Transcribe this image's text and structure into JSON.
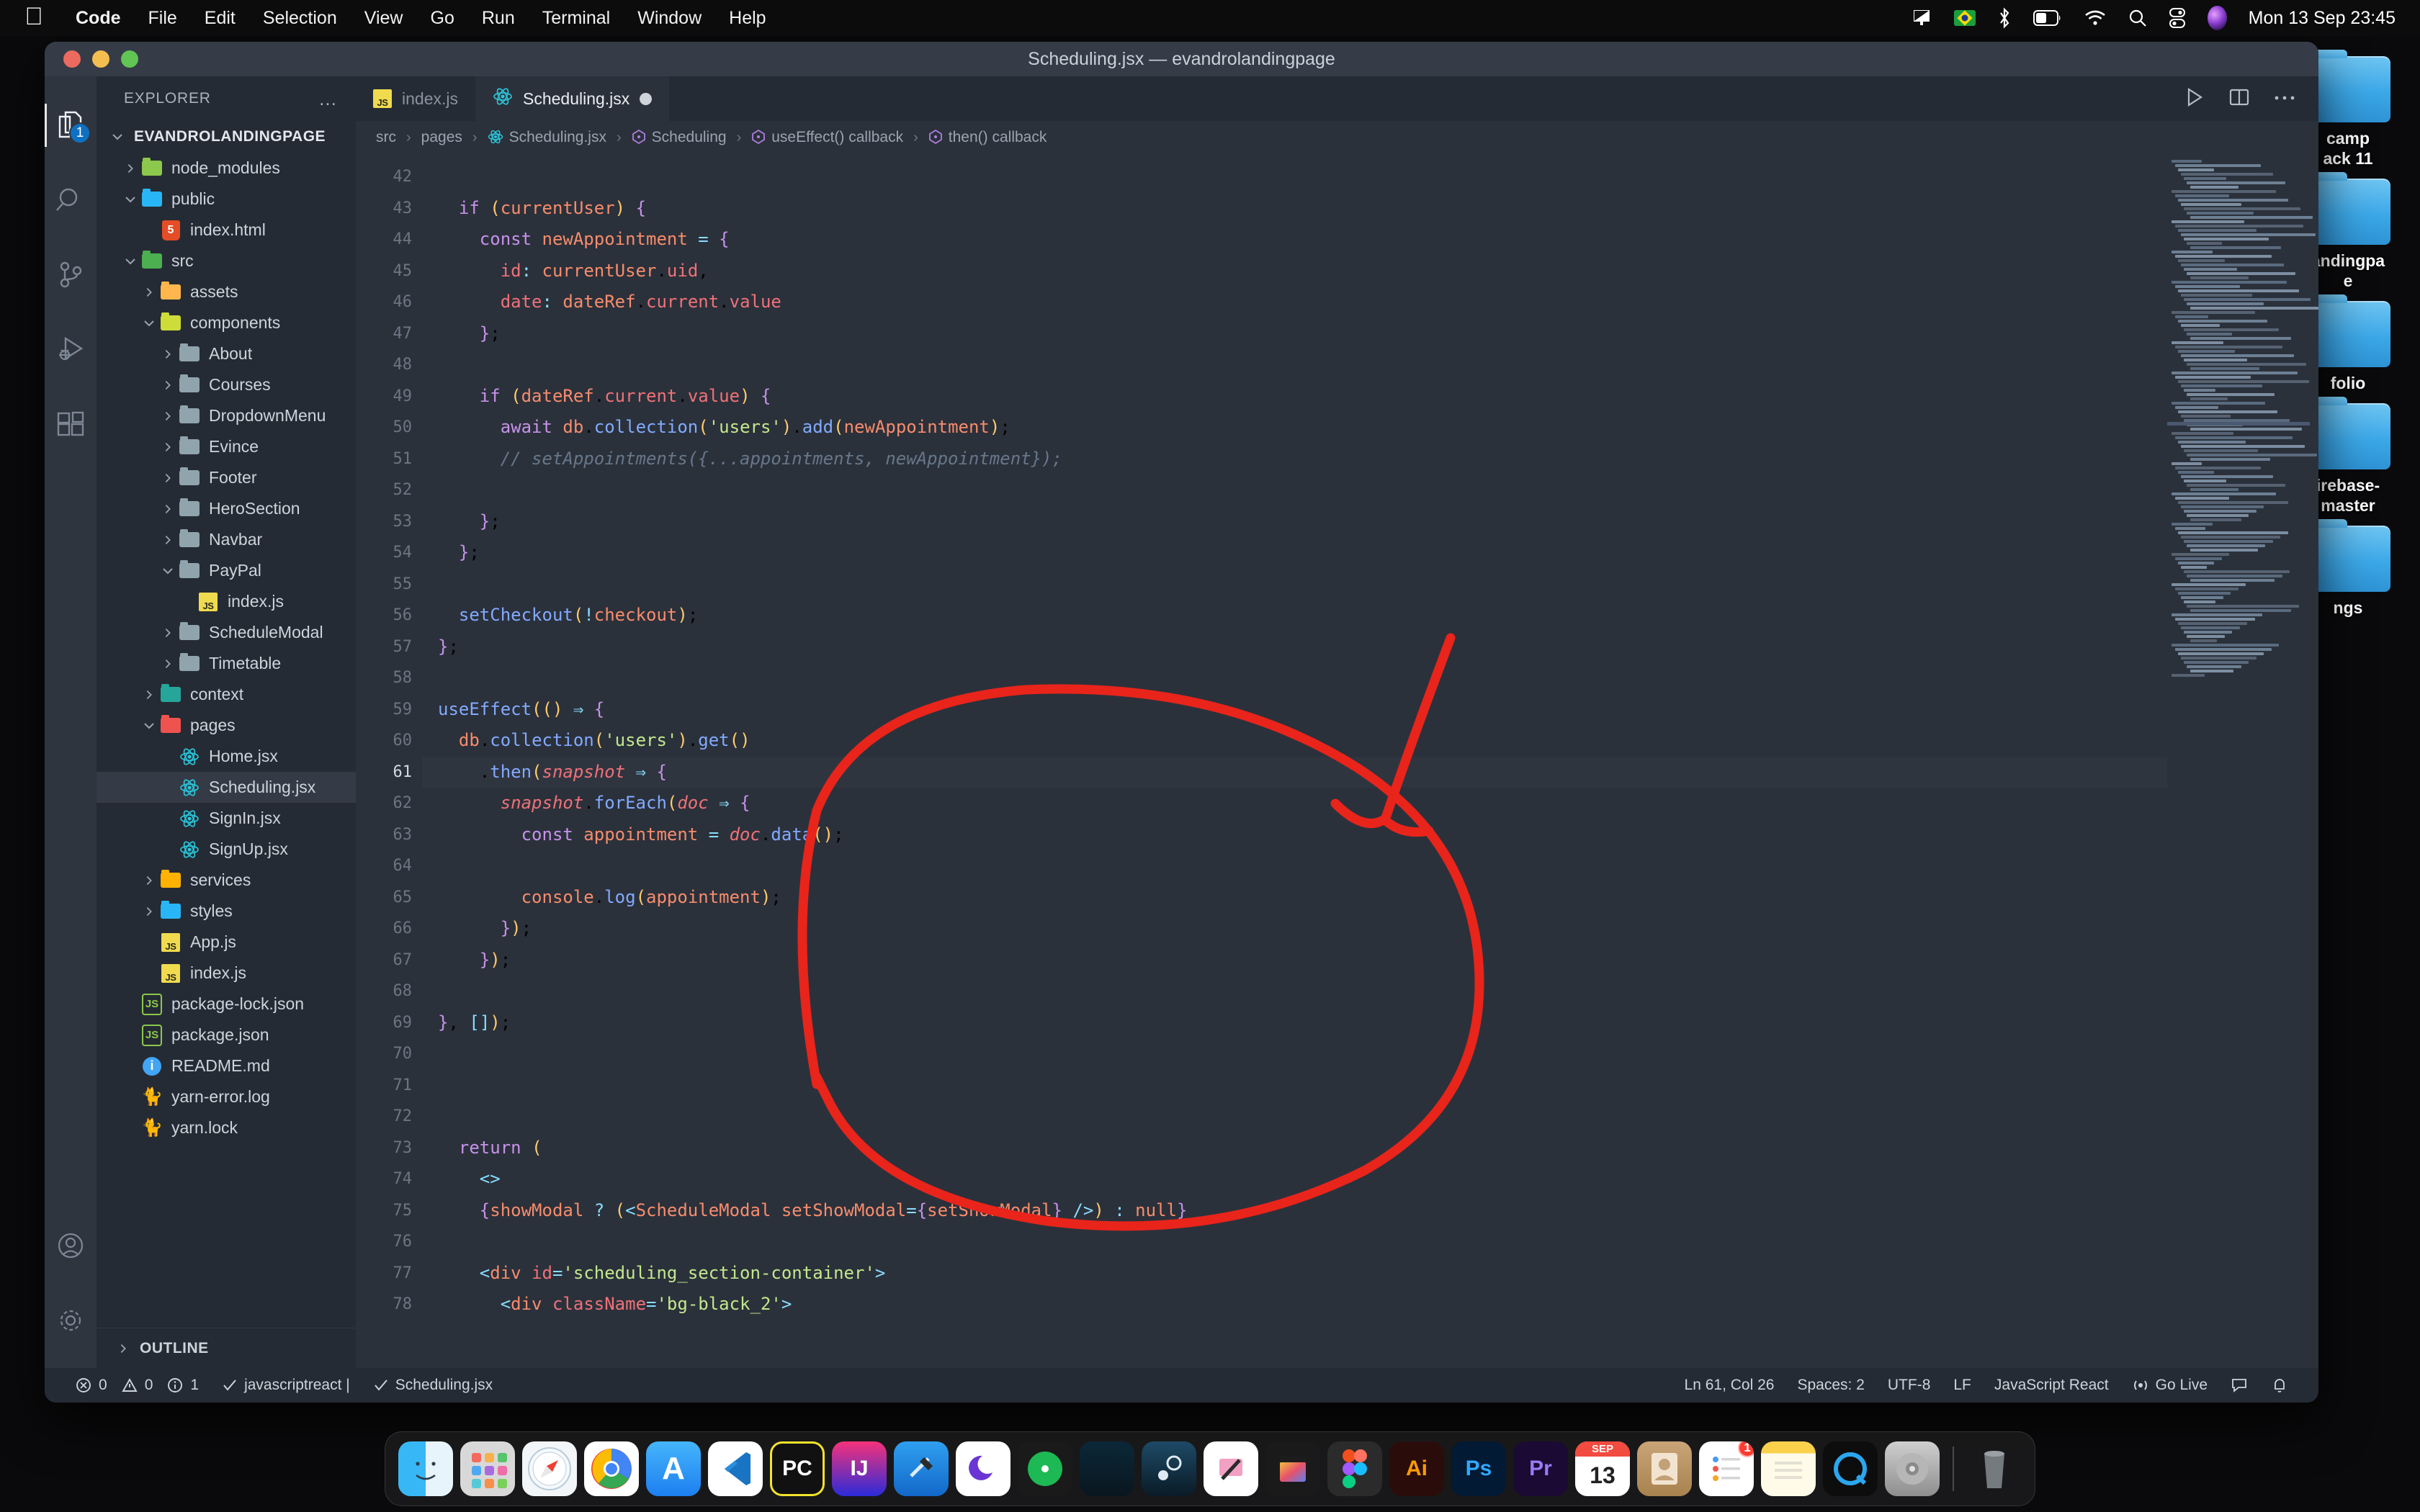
{
  "menubar": {
    "apple": "apple-logo",
    "items": [
      "Code",
      "File",
      "Edit",
      "Selection",
      "View",
      "Go",
      "Run",
      "Terminal",
      "Window",
      "Help"
    ],
    "status_icons": [
      "display-icon",
      "brazil-flag-icon",
      "bluetooth-icon",
      "battery-icon",
      "wifi-icon",
      "search-icon",
      "control-center-icon",
      "siri-icon"
    ],
    "clock": "Mon 13 Sep  23:45"
  },
  "window": {
    "title": "Scheduling.jsx — evandrolandingpage"
  },
  "activitybar": {
    "items": [
      {
        "name": "explorer",
        "icon": "files-icon",
        "badge": "1",
        "active": true
      },
      {
        "name": "search",
        "icon": "search-icon",
        "badge": "",
        "active": false
      },
      {
        "name": "source-control",
        "icon": "source-control-icon",
        "badge": "",
        "active": false
      },
      {
        "name": "run-debug",
        "icon": "run-debug-icon",
        "badge": "",
        "active": false
      },
      {
        "name": "extensions",
        "icon": "extensions-icon",
        "badge": "",
        "active": false
      }
    ],
    "bottom": [
      {
        "name": "accounts",
        "icon": "account-icon"
      },
      {
        "name": "settings",
        "icon": "gear-icon"
      }
    ]
  },
  "sidebar": {
    "title": "EXPLORER",
    "more_actions": "…",
    "root": "EVANDROLANDINGPAGE",
    "outline_label": "OUTLINE",
    "tree": [
      {
        "label": "node_modules",
        "depth": 1,
        "type": "folder",
        "state": "collapsed",
        "color": "#8cc84b"
      },
      {
        "label": "public",
        "depth": 1,
        "type": "folder",
        "state": "expanded",
        "color": "#29b6f6"
      },
      {
        "label": "index.html",
        "depth": 2,
        "type": "html"
      },
      {
        "label": "src",
        "depth": 1,
        "type": "folder",
        "state": "expanded",
        "color": "#4caf50"
      },
      {
        "label": "assets",
        "depth": 2,
        "type": "folder",
        "state": "collapsed",
        "color": "#ffb74d"
      },
      {
        "label": "components",
        "depth": 2,
        "type": "folder",
        "state": "expanded",
        "color": "#cddc39"
      },
      {
        "label": "About",
        "depth": 3,
        "type": "folder",
        "state": "collapsed",
        "color": "#90a4ae"
      },
      {
        "label": "Courses",
        "depth": 3,
        "type": "folder",
        "state": "collapsed",
        "color": "#90a4ae"
      },
      {
        "label": "DropdownMenu",
        "depth": 3,
        "type": "folder",
        "state": "collapsed",
        "color": "#90a4ae"
      },
      {
        "label": "Evince",
        "depth": 3,
        "type": "folder",
        "state": "collapsed",
        "color": "#90a4ae"
      },
      {
        "label": "Footer",
        "depth": 3,
        "type": "folder",
        "state": "collapsed",
        "color": "#90a4ae"
      },
      {
        "label": "HeroSection",
        "depth": 3,
        "type": "folder",
        "state": "collapsed",
        "color": "#90a4ae"
      },
      {
        "label": "Navbar",
        "depth": 3,
        "type": "folder",
        "state": "collapsed",
        "color": "#90a4ae"
      },
      {
        "label": "PayPal",
        "depth": 3,
        "type": "folder",
        "state": "expanded",
        "color": "#90a4ae"
      },
      {
        "label": "index.js",
        "depth": 4,
        "type": "js"
      },
      {
        "label": "ScheduleModal",
        "depth": 3,
        "type": "folder",
        "state": "collapsed",
        "color": "#90a4ae"
      },
      {
        "label": "Timetable",
        "depth": 3,
        "type": "folder",
        "state": "collapsed",
        "color": "#90a4ae"
      },
      {
        "label": "context",
        "depth": 2,
        "type": "folder",
        "state": "collapsed",
        "color": "#26a69a"
      },
      {
        "label": "pages",
        "depth": 2,
        "type": "folder",
        "state": "expanded",
        "color": "#ef5350"
      },
      {
        "label": "Home.jsx",
        "depth": 3,
        "type": "react"
      },
      {
        "label": "Scheduling.jsx",
        "depth": 3,
        "type": "react",
        "selected": true
      },
      {
        "label": "SignIn.jsx",
        "depth": 3,
        "type": "react"
      },
      {
        "label": "SignUp.jsx",
        "depth": 3,
        "type": "react"
      },
      {
        "label": "services",
        "depth": 2,
        "type": "folder",
        "state": "collapsed",
        "color": "#ffb300"
      },
      {
        "label": "styles",
        "depth": 2,
        "type": "folder",
        "state": "collapsed",
        "color": "#29b6f6"
      },
      {
        "label": "App.js",
        "depth": 2,
        "type": "js"
      },
      {
        "label": "index.js",
        "depth": 2,
        "type": "js"
      },
      {
        "label": "package-lock.json",
        "depth": 1,
        "type": "node"
      },
      {
        "label": "package.json",
        "depth": 1,
        "type": "node"
      },
      {
        "label": "README.md",
        "depth": 1,
        "type": "info"
      },
      {
        "label": "yarn-error.log",
        "depth": 1,
        "type": "yarn"
      },
      {
        "label": "yarn.lock",
        "depth": 1,
        "type": "yarn"
      }
    ]
  },
  "tabs": [
    {
      "label": "index.js",
      "icon": "js-icon",
      "active": false,
      "dirty": false
    },
    {
      "label": "Scheduling.jsx",
      "icon": "react-icon",
      "active": true,
      "dirty": true
    }
  ],
  "editor_actions": [
    {
      "name": "run-button",
      "icon": "play-icon"
    },
    {
      "name": "split-editor-button",
      "icon": "split-editor-icon"
    },
    {
      "name": "more-actions-button",
      "icon": "ellipsis-icon"
    }
  ],
  "breadcrumbs": [
    {
      "label": "src",
      "icon": ""
    },
    {
      "label": "pages",
      "icon": ""
    },
    {
      "label": "Scheduling.jsx",
      "icon": "react-icon"
    },
    {
      "label": "Scheduling",
      "icon": "symbol-icon"
    },
    {
      "label": "useEffect() callback",
      "icon": "symbol-icon"
    },
    {
      "label": "then() callback",
      "icon": "symbol-icon"
    }
  ],
  "code": {
    "first_line": 42,
    "current_line": 61,
    "lines": [
      {
        "n": 42,
        "text": ""
      },
      {
        "n": 43,
        "text": "  if (currentUser) {"
      },
      {
        "n": 44,
        "text": "    const newAppointment = {"
      },
      {
        "n": 45,
        "text": "      id: currentUser.uid,"
      },
      {
        "n": 46,
        "text": "      date: dateRef.current.value"
      },
      {
        "n": 47,
        "text": "    };"
      },
      {
        "n": 48,
        "text": ""
      },
      {
        "n": 49,
        "text": "    if (dateRef.current.value) {"
      },
      {
        "n": 50,
        "text": "      await db.collection('users').add(newAppointment);"
      },
      {
        "n": 51,
        "text": "      // setAppointments({...appointments, newAppointment});"
      },
      {
        "n": 52,
        "text": ""
      },
      {
        "n": 53,
        "text": "    };"
      },
      {
        "n": 54,
        "text": "  };"
      },
      {
        "n": 55,
        "text": ""
      },
      {
        "n": 56,
        "text": "  setCheckout(!checkout);"
      },
      {
        "n": 57,
        "text": "};"
      },
      {
        "n": 58,
        "text": ""
      },
      {
        "n": 59,
        "text": "useEffect(() => {"
      },
      {
        "n": 60,
        "text": "  db.collection('users').get()"
      },
      {
        "n": 61,
        "text": "    .then(snapshot => {"
      },
      {
        "n": 62,
        "text": "      snapshot.forEach(doc => {"
      },
      {
        "n": 63,
        "text": "        const appointment = doc.data();"
      },
      {
        "n": 64,
        "text": ""
      },
      {
        "n": 65,
        "text": "        console.log(appointment);"
      },
      {
        "n": 66,
        "text": "      });"
      },
      {
        "n": 67,
        "text": "    });"
      },
      {
        "n": 68,
        "text": ""
      },
      {
        "n": 69,
        "text": "}, []);"
      },
      {
        "n": 70,
        "text": ""
      },
      {
        "n": 71,
        "text": ""
      },
      {
        "n": 72,
        "text": ""
      },
      {
        "n": 73,
        "text": "  return ("
      },
      {
        "n": 74,
        "text": "    <>"
      },
      {
        "n": 75,
        "text": "    {showModal ? (<ScheduleModal setShowModal={setShowModal} />) : null}"
      },
      {
        "n": 76,
        "text": ""
      },
      {
        "n": 77,
        "text": "    <div id='scheduling_section-container'>"
      },
      {
        "n": 78,
        "text": "      <div className='bg-black_2'>"
      }
    ]
  },
  "annotation": {
    "color": "#e8241b",
    "shapes": [
      "ellipse-around-useeffect-block",
      "arrow-pointing-down-left"
    ]
  },
  "statusbar": {
    "left": [
      {
        "name": "errors",
        "icon": "error-icon",
        "text": "0"
      },
      {
        "name": "warnings",
        "icon": "warning-icon",
        "text": "0"
      },
      {
        "name": "infos",
        "icon": "info-icon",
        "text": "1"
      },
      {
        "name": "eslint",
        "icon": "check-icon",
        "text": "javascriptreact |"
      },
      {
        "name": "prettier",
        "icon": "check-icon",
        "text": "Scheduling.jsx"
      }
    ],
    "right": [
      {
        "name": "cursor-position",
        "text": "Ln 61, Col 26"
      },
      {
        "name": "indentation",
        "text": "Spaces: 2"
      },
      {
        "name": "encoding",
        "text": "UTF-8"
      },
      {
        "name": "eol",
        "text": "LF"
      },
      {
        "name": "language-mode",
        "text": "JavaScript React"
      },
      {
        "name": "go-live",
        "icon": "broadcast-icon",
        "text": "Go Live"
      },
      {
        "name": "remote-feedback",
        "icon": "feedback-icon",
        "text": ""
      },
      {
        "name": "notifications",
        "icon": "bell-icon",
        "text": ""
      }
    ]
  },
  "desktop": {
    "icons": [
      {
        "label": "camp\nack 11"
      },
      {
        "label": "andingpa\ne"
      },
      {
        "label": "folio"
      },
      {
        "label": "irebase-\nmaster"
      },
      {
        "label": "ngs"
      }
    ]
  },
  "dock": {
    "apps": [
      {
        "name": "finder",
        "label": "",
        "running": true
      },
      {
        "name": "launchpad",
        "label": "",
        "running": false
      },
      {
        "name": "safari",
        "label": "",
        "running": false
      },
      {
        "name": "chrome",
        "label": "",
        "running": true
      },
      {
        "name": "app-store",
        "label": "",
        "running": false
      },
      {
        "name": "vscode",
        "label": "",
        "running": true
      },
      {
        "name": "pycharm",
        "label": "PC",
        "running": false
      },
      {
        "name": "intellij-idea",
        "label": "IJ",
        "running": false
      },
      {
        "name": "xcode",
        "label": "",
        "running": false
      },
      {
        "name": "insomnia",
        "label": "",
        "running": false
      },
      {
        "name": "spotify",
        "label": "",
        "running": false
      },
      {
        "name": "league-of-legends",
        "label": "",
        "running": false
      },
      {
        "name": "steam",
        "label": "",
        "running": false
      },
      {
        "name": "sketch",
        "label": "",
        "running": false
      },
      {
        "name": "final-cut-pro",
        "label": "",
        "running": false
      },
      {
        "name": "figma",
        "label": "",
        "running": false
      },
      {
        "name": "illustrator",
        "label": "Ai",
        "running": false
      },
      {
        "name": "photoshop",
        "label": "Ps",
        "running": false
      },
      {
        "name": "premiere-pro",
        "label": "Pr",
        "running": false
      },
      {
        "name": "calendar",
        "label": "13",
        "sublabel": "SEP",
        "running": false
      },
      {
        "name": "contacts",
        "label": "",
        "running": false
      },
      {
        "name": "reminders",
        "label": "",
        "badge": "1",
        "running": false
      },
      {
        "name": "notes",
        "label": "",
        "running": false
      },
      {
        "name": "quicktime",
        "label": "",
        "running": false
      },
      {
        "name": "system-preferences",
        "label": "",
        "running": false
      }
    ],
    "trash": "trash-icon"
  }
}
